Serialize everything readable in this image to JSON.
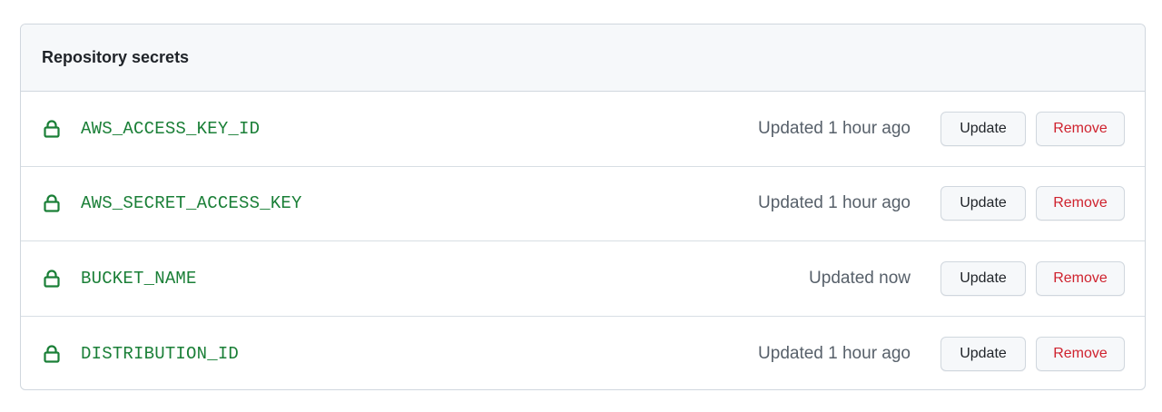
{
  "panel": {
    "title": "Repository secrets"
  },
  "secrets": [
    {
      "name": "AWS_ACCESS_KEY_ID",
      "updated": "Updated 1 hour ago",
      "update_label": "Update",
      "remove_label": "Remove"
    },
    {
      "name": "AWS_SECRET_ACCESS_KEY",
      "updated": "Updated 1 hour ago",
      "update_label": "Update",
      "remove_label": "Remove"
    },
    {
      "name": "BUCKET_NAME",
      "updated": "Updated now",
      "update_label": "Update",
      "remove_label": "Remove"
    },
    {
      "name": "DISTRIBUTION_ID",
      "updated": "Updated 1 hour ago",
      "update_label": "Update",
      "remove_label": "Remove"
    }
  ],
  "icons": {
    "row_icon": "lock-icon"
  },
  "colors": {
    "secret_name": "#1a7f37",
    "remove_text": "#cf222e",
    "header_bg": "#f6f8fa"
  }
}
